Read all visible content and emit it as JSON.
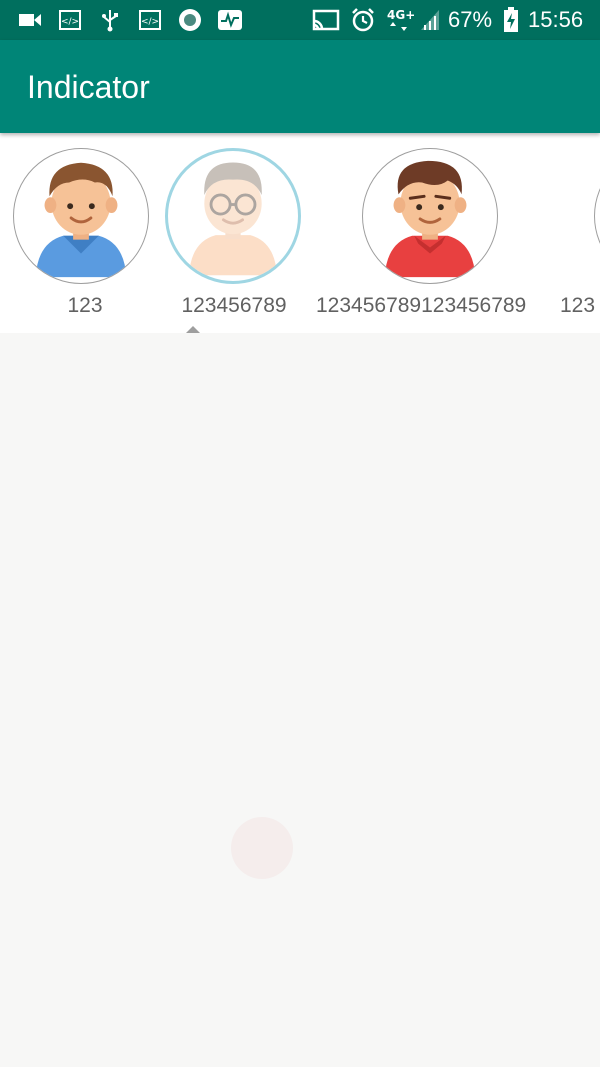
{
  "status_bar": {
    "battery_percent": "67%",
    "time": "15:56",
    "network_label": "4G+",
    "icons": [
      "video-camera-icon",
      "code-icon",
      "usb-icon",
      "code-icon",
      "record-icon",
      "activity-icon",
      "cast-icon",
      "alarm-icon",
      "network-4g-icon",
      "signal-icon",
      "battery-charging-icon"
    ]
  },
  "app_bar": {
    "title": "Indicator"
  },
  "indicator": {
    "items": [
      {
        "label": "123",
        "selected": false,
        "shirt_color": "#5a9be0"
      },
      {
        "label": "123456789",
        "selected": true,
        "shirt_color": "#f7c7a0"
      },
      {
        "label": "123456789123456789",
        "selected": false,
        "shirt_color": "#e84040"
      },
      {
        "label": "123",
        "selected": false,
        "shirt_color": "#5a9be0"
      }
    ]
  },
  "colors": {
    "status_bar": "#006f5e",
    "app_bar": "#008577",
    "selected_ring": "#9fd6e3",
    "label_text": "#616161"
  }
}
